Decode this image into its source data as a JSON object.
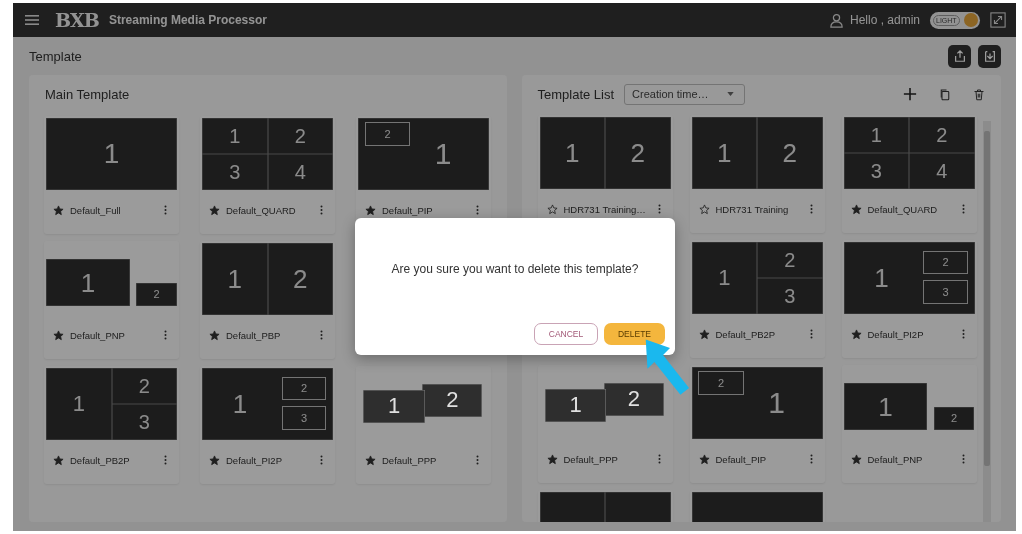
{
  "header": {
    "logo": "BXB",
    "app_name": "Streaming Media Processor",
    "greeting": "Hello , admin",
    "theme_toggle": {
      "label": "LIGHT",
      "on": true
    }
  },
  "page": {
    "title": "Template"
  },
  "main_template": {
    "title": "Main Template",
    "rows": [
      {
        "cards": [
          {
            "name": "Default_Full",
            "kind": "full",
            "cells": [
              "1"
            ],
            "favorite": true
          },
          {
            "name": "Default_QUARD",
            "kind": "quad",
            "cells": [
              "1",
              "2",
              "3",
              "4"
            ],
            "favorite": true
          },
          {
            "name": "Default_PIP",
            "kind": "pip",
            "cells": [
              "1",
              "2"
            ],
            "favorite": true
          }
        ]
      },
      {
        "cards": [
          {
            "name": "Default_PNP",
            "kind": "pnp",
            "cells": [
              "1",
              "2"
            ],
            "favorite": true
          },
          {
            "name": "Default_PBP",
            "kind": "pbp",
            "cells": [
              "1",
              "2"
            ],
            "favorite": true
          }
        ]
      },
      {
        "cards": [
          {
            "name": "Default_PB2P",
            "kind": "pb2p",
            "cells": [
              "1",
              "2",
              "3"
            ],
            "favorite": true
          },
          {
            "name": "Default_PI2P",
            "kind": "pi2p",
            "cells": [
              "1",
              "2",
              "3"
            ],
            "favorite": true
          },
          {
            "name": "Default_PPP",
            "kind": "ppp",
            "cells": [
              "1",
              "2"
            ],
            "favorite": true
          }
        ]
      }
    ]
  },
  "template_list": {
    "title": "Template List",
    "sort": {
      "value": "Creation time…"
    },
    "rows": [
      {
        "kind": "normal",
        "cards": [
          {
            "name": "HDR731 Training…",
            "kind": "pbp",
            "cells": [
              "1",
              "2"
            ],
            "favorite": false
          },
          {
            "name": "HDR731 Training",
            "kind": "pbp",
            "cells": [
              "1",
              "2"
            ],
            "favorite": false
          },
          {
            "name": "Default_QUARD",
            "kind": "quad",
            "cells": [
              "1",
              "2",
              "3",
              "4"
            ],
            "favorite": true
          }
        ]
      },
      {
        "kind": "trailing",
        "cards": [
          {
            "name": "Default_PB2P",
            "kind": "pb2p",
            "cells": [
              "1",
              "2",
              "3"
            ],
            "favorite": true
          },
          {
            "name": "Default_PI2P",
            "kind": "pi2p",
            "cells": [
              "1",
              "2",
              "3"
            ],
            "favorite": true
          }
        ]
      },
      {
        "kind": "normal",
        "cards": [
          {
            "name": "Default_PPP",
            "kind": "ppp",
            "cells": [
              "1",
              "2"
            ],
            "favorite": true
          },
          {
            "name": "Default_PIP",
            "kind": "pip",
            "cells": [
              "1",
              "2"
            ],
            "favorite": true
          },
          {
            "name": "Default_PNP",
            "kind": "pnp",
            "cells": [
              "1",
              "2"
            ],
            "favorite": true
          }
        ]
      },
      {
        "kind": "normal",
        "cards": [
          {
            "kind": "pbp"
          },
          {
            "kind": "full"
          }
        ]
      }
    ]
  },
  "dialog": {
    "message": "Are you sure you want to delete this template?",
    "buttons": [
      {
        "label": "CANCEL",
        "kind": "secondary"
      },
      {
        "label": "DELETE",
        "kind": "primary"
      }
    ]
  }
}
